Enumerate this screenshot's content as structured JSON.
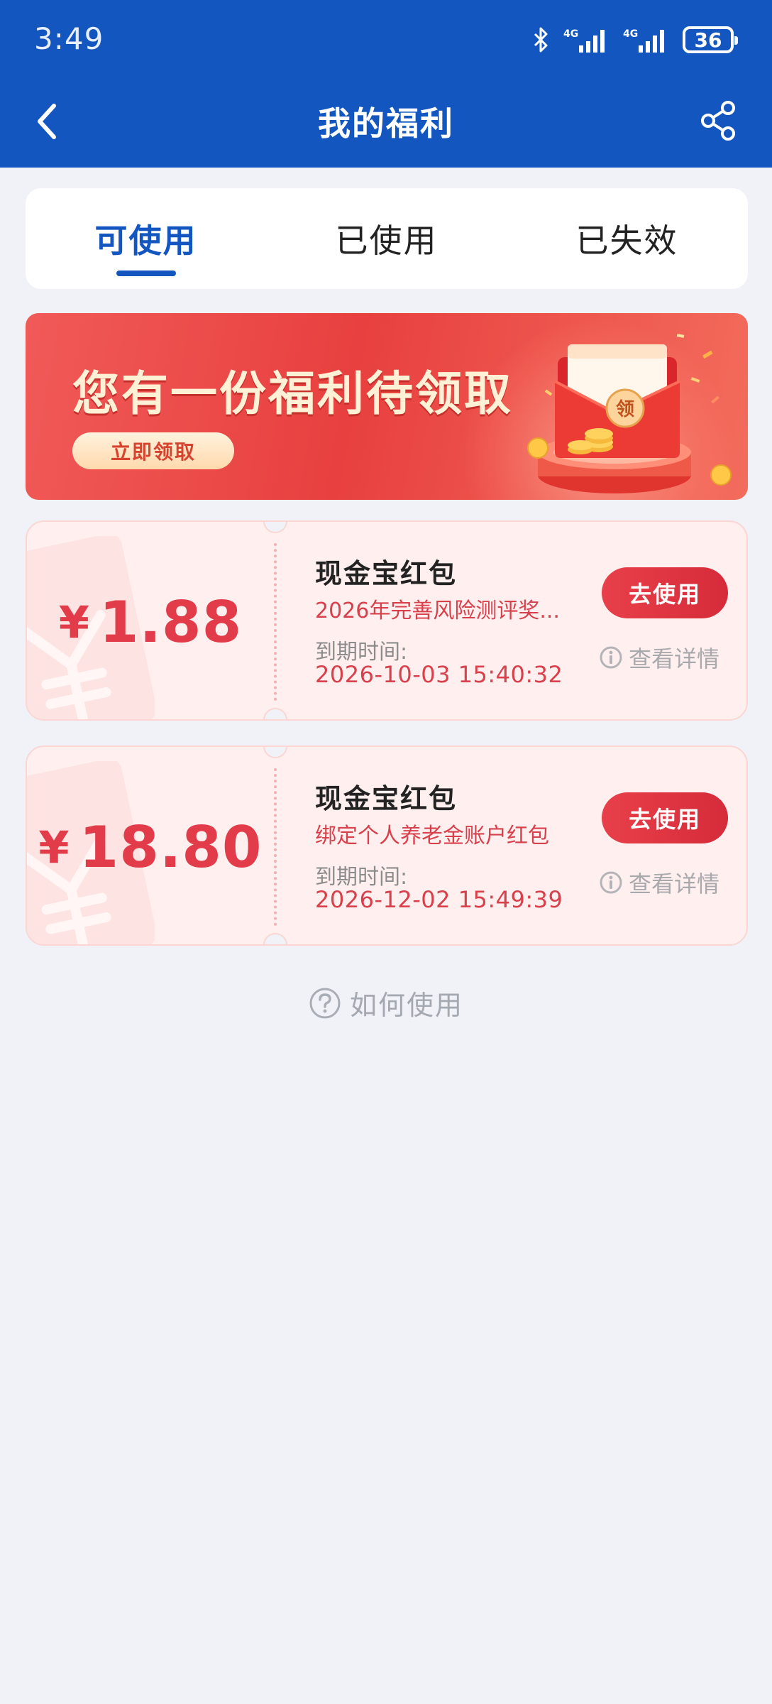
{
  "status_bar": {
    "time": "3:49",
    "battery": "36",
    "icons": [
      "bluetooth-icon",
      "signal-4g-icon",
      "signal-4g-icon",
      "battery-icon"
    ]
  },
  "nav": {
    "title": "我的福利",
    "back_icon": "chevron-left-icon",
    "share_icon": "share-icon"
  },
  "tabs": [
    {
      "label": "可使用",
      "active": true
    },
    {
      "label": "已使用",
      "active": false
    },
    {
      "label": "已失效",
      "active": false
    }
  ],
  "banner": {
    "title": "您有一份福利待领取",
    "button_label": "立即领取",
    "art_label": "领"
  },
  "coupons": [
    {
      "currency": "¥",
      "amount": "1.88",
      "title": "现金宝红包",
      "description": "2026年完善风险测评奖...",
      "expiry_label": "到期时间:",
      "expiry": "2026-10-03 15:40:32",
      "use_label": "去使用",
      "detail_label": "查看详情"
    },
    {
      "currency": "¥",
      "amount": "18.80",
      "title": "现金宝红包",
      "description": "绑定个人养老金账户红包",
      "expiry_label": "到期时间:",
      "expiry": "2026-12-02 15:49:39",
      "use_label": "去使用",
      "detail_label": "查看详情"
    }
  ],
  "how_to_use": "如何使用",
  "colors": {
    "brand_blue": "#1456c0",
    "accent_red": "#e23c4a",
    "page_bg": "#f0f2f7"
  }
}
